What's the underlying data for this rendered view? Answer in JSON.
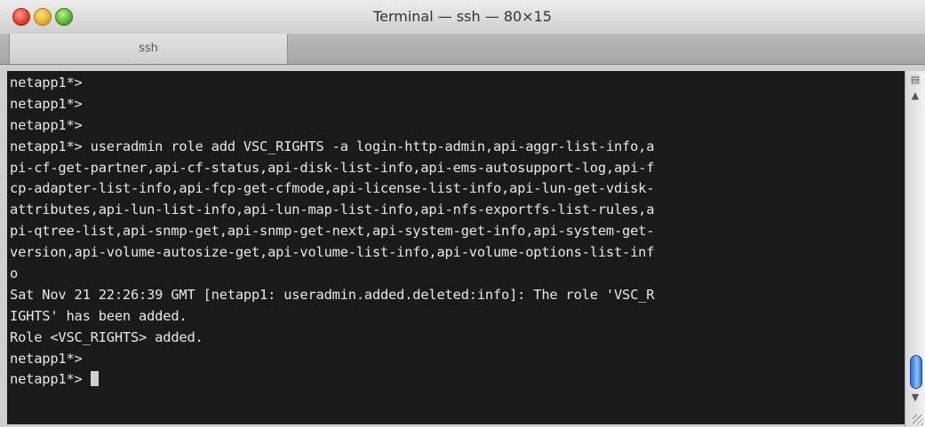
{
  "window": {
    "title": "Terminal — ssh — 80×15",
    "tab_label": "ssh"
  },
  "terminal": {
    "lines": [
      "netapp1*>",
      "netapp1*>",
      "netapp1*>",
      "netapp1*> useradmin role add VSC_RIGHTS -a login-http-admin,api-aggr-list-info,a",
      "pi-cf-get-partner,api-cf-status,api-disk-list-info,api-ems-autosupport-log,api-f",
      "cp-adapter-list-info,api-fcp-get-cfmode,api-license-list-info,api-lun-get-vdisk-",
      "attributes,api-lun-list-info,api-lun-map-list-info,api-nfs-exportfs-list-rules,a",
      "pi-qtree-list,api-snmp-get,api-snmp-get-next,api-system-get-info,api-system-get-",
      "version,api-volume-autosize-get,api-volume-list-info,api-volume-options-list-inf",
      "o",
      "Sat Nov 21 22:26:39 GMT [netapp1: useradmin.added.deleted:info]: The role 'VSC_R",
      "IGHTS' has been added.",
      "Role <VSC_RIGHTS> added.",
      "netapp1*>"
    ],
    "prompt": "netapp1*> "
  },
  "colors": {
    "background": "#1a1a1a",
    "foreground": "#e8e8e8",
    "scroll_thumb": "#3b7be0"
  },
  "icons": {
    "scroll_up": "triangle-up-icon",
    "scroll_down": "triangle-down-icon",
    "bookmark": "bookmark-icon"
  }
}
